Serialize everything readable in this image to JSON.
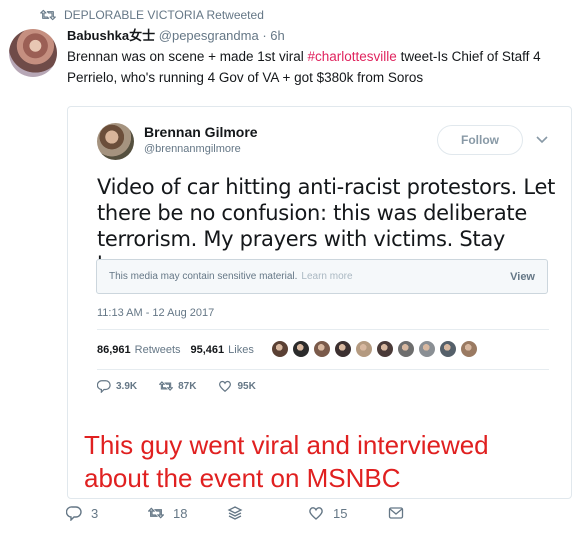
{
  "retweet_header": {
    "text": "DEPLORABLE VICTORIA Retweeted"
  },
  "tweet": {
    "name": "Babushka女士",
    "handle": "@pepesgrandma",
    "separator": "·",
    "time": "6h",
    "text_before": "Brennan was on scene + made 1st viral ",
    "hashtag": "#charlottesville",
    "text_after": " tweet-Is Chief of Staff 4 Perrielo, who's running 4 Gov of VA + got $380k from Soros"
  },
  "quoted": {
    "name": "Brennan Gilmore",
    "handle": "@brennanmgilmore",
    "follow_label": "Follow",
    "text": "Video of car hitting anti-racist protestors. Let there be no confusion: this was deliberate terrorism. My prayers with victims. Stay home.",
    "sensitive_text": "This media may contain sensitive material.",
    "learn_more": "Learn more",
    "view_label": "View",
    "timestamp": "11:13 AM - 12 Aug 2017",
    "retweets_count": "86,961",
    "retweets_label": "Retweets",
    "likes_count": "95,461",
    "likes_label": "Likes",
    "liker_colors": [
      "#5a4034",
      "#2b2b2b",
      "#7a5a4a",
      "#3c3030",
      "#b49a80",
      "#4a3a38",
      "#6d6d6d",
      "#8a8f94",
      "#55606a",
      "#9a7a62"
    ],
    "replies": "3.9K",
    "retweets_short": "87K",
    "likes_short": "95K"
  },
  "annotation": {
    "line1": "This guy went viral and interviewed",
    "line2": "about the event on MSNBC"
  },
  "actions": {
    "replies": "3",
    "retweets": "18",
    "likes": "15"
  },
  "colors": {
    "hashtag": "#e0245e",
    "annotation": "#e02020",
    "meta": "#657786"
  }
}
